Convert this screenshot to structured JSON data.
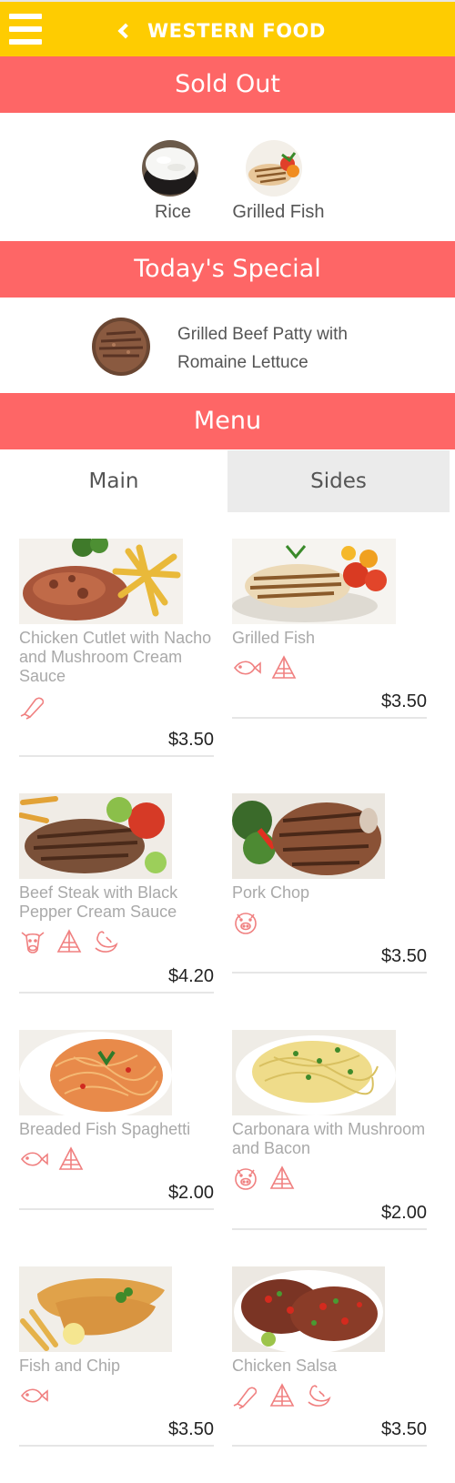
{
  "header": {
    "title": "WESTERN FOOD",
    "menu_icon": "hamburger-menu-icon",
    "back_icon": "chevron-left-icon",
    "bg_color": "#fecc01"
  },
  "sections": {
    "sold_out": "Sold Out",
    "todays_special": "Today's Special",
    "menu": "Menu",
    "band_color": "#fe6666"
  },
  "sold_out": [
    {
      "label": "Rice"
    },
    {
      "label": "Grilled Fish"
    }
  ],
  "special": {
    "label": "Grilled Beef Patty with Romaine Lettuce"
  },
  "tabs": [
    {
      "label": "Main",
      "selected": true
    },
    {
      "label": "Sides",
      "selected": false
    }
  ],
  "menu_items": [
    {
      "name": "Chicken Cutlet with Nacho and Mushroom Cream Sauce",
      "price": "$3.50",
      "icons": [
        "chicken-icon"
      ]
    },
    {
      "name": "Grilled Fish",
      "price": "$3.50",
      "icons": [
        "fish-icon",
        "wheat-icon"
      ]
    },
    {
      "name": "Beef Steak with Black Pepper Cream Sauce",
      "price": "$4.20",
      "icons": [
        "cow-icon",
        "wheat-icon",
        "chili-icon"
      ]
    },
    {
      "name": "Pork Chop",
      "price": "$3.50",
      "icons": [
        "pig-icon"
      ]
    },
    {
      "name": "Breaded Fish Spaghetti",
      "price": "$2.00",
      "icons": [
        "fish-icon",
        "wheat-icon"
      ]
    },
    {
      "name": "Carbonara with Mushroom and Bacon",
      "price": "$2.00",
      "icons": [
        "pig-icon",
        "wheat-icon"
      ]
    },
    {
      "name": "Fish and Chip",
      "price": "$3.50",
      "icons": [
        "fish-icon"
      ]
    },
    {
      "name": "Chicken Salsa",
      "price": "$3.50",
      "icons": [
        "chicken-icon",
        "wheat-icon",
        "chili-icon"
      ]
    }
  ]
}
